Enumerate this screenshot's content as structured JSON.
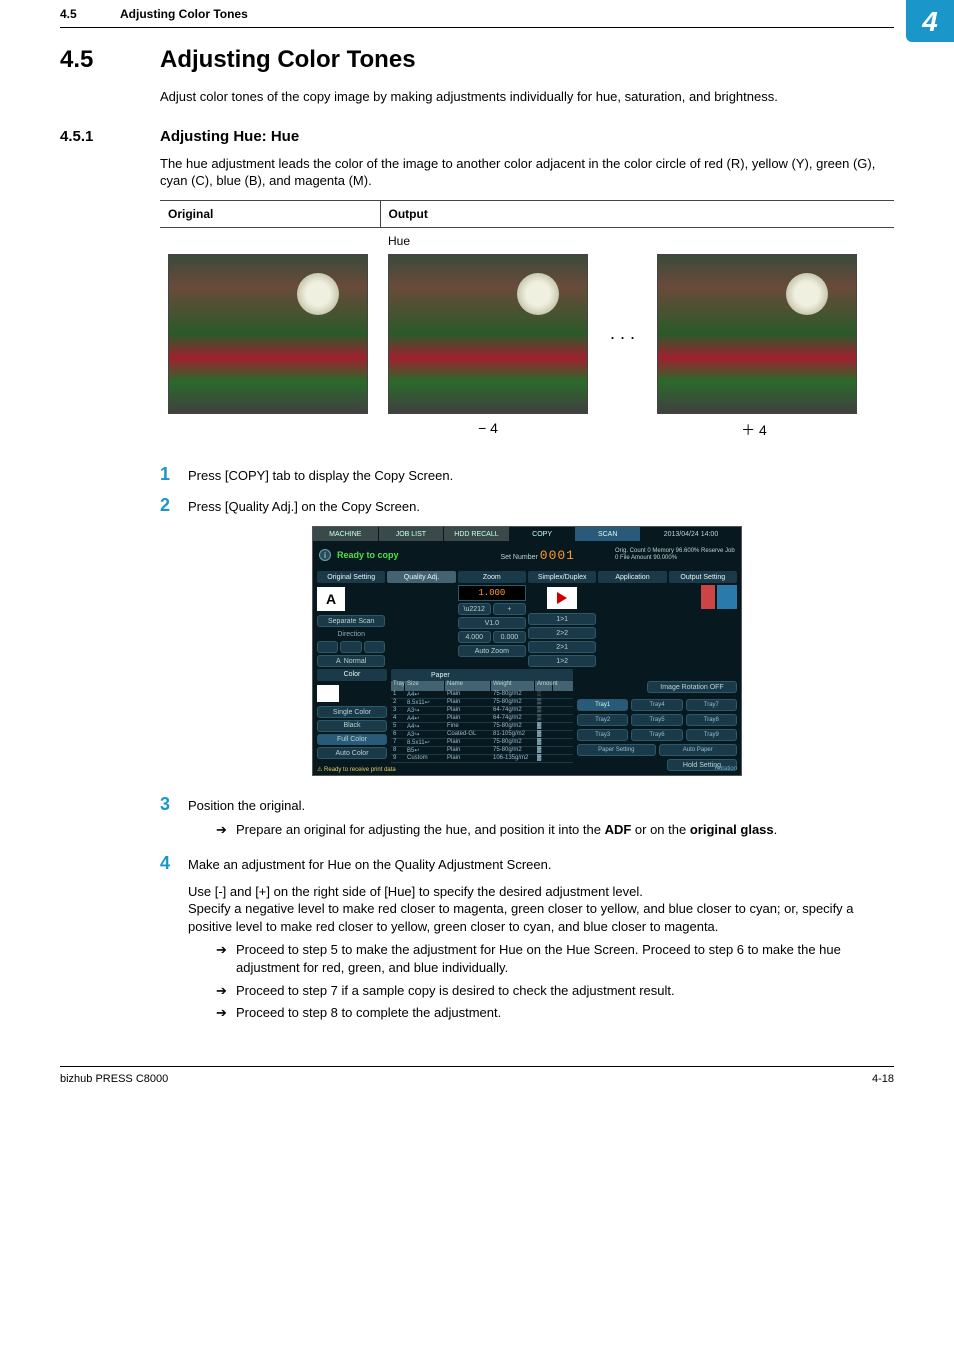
{
  "header": {
    "section_number": "4.5",
    "section_title": "Adjusting Color Tones",
    "corner_badge": "4"
  },
  "heading_main": {
    "number": "4.5",
    "title": "Adjusting Color Tones",
    "intro": "Adjust color tones of the copy image by making adjustments individually for hue, saturation, and brightness."
  },
  "heading_sub": {
    "number": "4.5.1",
    "title": "Adjusting Hue: Hue",
    "intro": "The hue adjustment leads the color of the image to another color adjacent in the color circle of red (R), yellow (Y), green (G), cyan (C), blue (B), and magenta (M)."
  },
  "oo_table": {
    "h_original": "Original",
    "h_output": "Output",
    "hue_label": "Hue",
    "dots": ". . .",
    "cap_minus": "− 4",
    "cap_plus": "＋ 4"
  },
  "steps": [
    {
      "n": "1",
      "text": "Press [COPY] tab to display the Copy Screen."
    },
    {
      "n": "2",
      "text": "Press [Quality Adj.] on the Copy Screen."
    },
    {
      "n": "3",
      "text": "Position the original.",
      "subs": [
        {
          "arrow": "➔",
          "html": "Prepare an original for adjusting the hue, and position it into the <b>ADF</b> or on the <b>original glass</b>."
        }
      ]
    },
    {
      "n": "4",
      "text": "Make an adjustment for Hue on the Quality Adjustment Screen.",
      "para": "Use [-] and [+] on the right side of [Hue] to specify the desired adjustment level.\nSpecify a negative level to make red closer to magenta, green closer to yellow, and blue closer to cyan; or, specify a positive level to make red closer to yellow, green closer to cyan, and blue closer to magenta.",
      "subs": [
        {
          "arrow": "➔",
          "text": "Proceed to step 5 to make the adjustment for Hue on the Hue Screen. Proceed to step 6 to make the hue adjustment for red, green, and blue individually."
        },
        {
          "arrow": "➔",
          "text": "Proceed to step 7 if a sample copy is desired to check the adjustment result."
        },
        {
          "arrow": "➔",
          "text": "Proceed to step 8 to complete the adjustment."
        }
      ]
    }
  ],
  "screenshot": {
    "tabs": [
      "MACHINE",
      "JOB LIST",
      "HDD RECALL",
      "COPY",
      "SCAN"
    ],
    "active_tab": 3,
    "timestamp": "2013/04/24 14:00",
    "ready": "Ready to copy",
    "set_number_label": "Set Number",
    "set_number_value": "0001",
    "mem_lines": "Orig. Count     0   Memory     96.600%\nReserve Job     0   File Amount 90.000%",
    "col_headers": [
      "Original Setting",
      "Quality Adj.",
      "Zoom",
      "Simplex/Duplex",
      "Application",
      "Output Setting"
    ],
    "zoom_value": "1.000",
    "zoom_v": "V1.0",
    "zoom_btns": [
      "4.000",
      "0.000"
    ],
    "auto_zoom": "Auto Zoom",
    "sep_scan": "Separate Scan",
    "direction_label": "Direction",
    "normal_label": "Normal",
    "duplex": [
      "1>1",
      "2>2",
      "2>1",
      "1>2"
    ],
    "lower_headers": [
      "Color",
      "Paper"
    ],
    "color_buttons": [
      "Single Color",
      "Black",
      "Full Color",
      "Auto Color"
    ],
    "paper_cols": [
      "Tray",
      "Size",
      "Name",
      "Weight",
      "Amount"
    ],
    "paper_rows": [
      [
        "1",
        "A4↩",
        "Plain",
        "75-80g/m2",
        "░"
      ],
      [
        "2",
        "8.5x11↩",
        "Plain",
        "75-80g/m2",
        "▒"
      ],
      [
        "3",
        "A3↪",
        "Plain",
        "64-74g/m2",
        "▒"
      ],
      [
        "4",
        "A4↩",
        "Plain",
        "64-74g/m2",
        "▒"
      ],
      [
        "5",
        "A4↪",
        "Fine",
        "75-80g/m2",
        "▓"
      ],
      [
        "6",
        "A3↪",
        "Coated-GL",
        "81-105g/m2",
        "▓"
      ],
      [
        "7",
        "8.5x11↩",
        "Plain",
        "75-80g/m2",
        "▓"
      ],
      [
        "8",
        "B5↩",
        "Plain",
        "75-80g/m2",
        "▓"
      ],
      [
        "9",
        "Custom",
        "Plain",
        "106-135g/m2",
        "▓"
      ]
    ],
    "image_rotation": "Image Rotation OFF",
    "trays_row1": [
      "Tray1",
      "Tray4",
      "Tray7"
    ],
    "trays_row2": [
      "Tray2",
      "Tray5",
      "Tray8"
    ],
    "trays_row3": [
      "Tray3",
      "Tray6",
      "Tray9"
    ],
    "paper_setting": "Paper Setting",
    "auto_paper": "Auto Paper",
    "hold_setting": "Hold Setting",
    "rotation": "Rotation",
    "foot_warn": "⚠ Ready to receive print data"
  },
  "footer": {
    "left": "bizhub PRESS C8000",
    "right": "4-18"
  }
}
